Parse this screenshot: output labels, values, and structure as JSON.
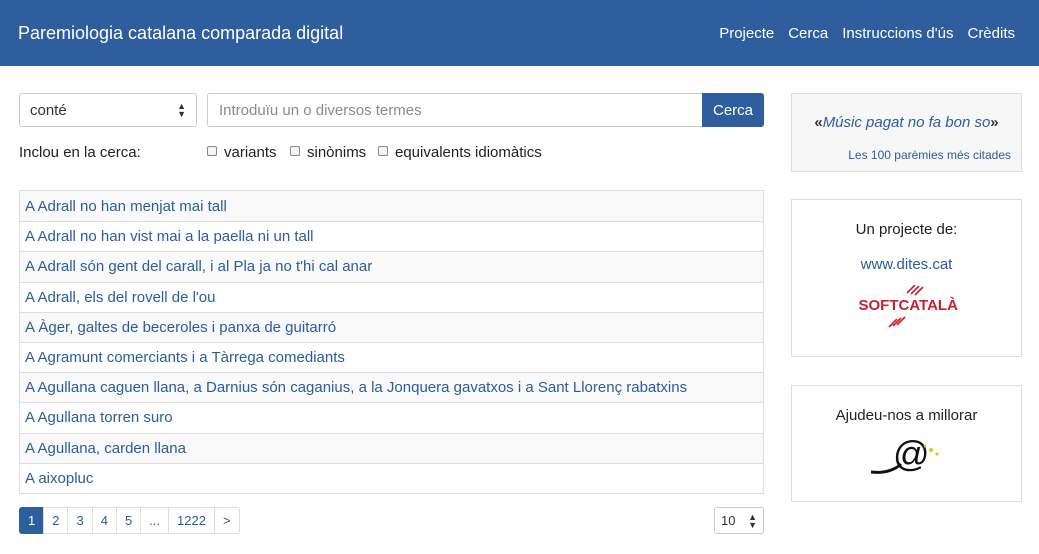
{
  "navbar": {
    "brand": "Paremiologia catalana comparada digital",
    "links": [
      "Projecte",
      "Cerca",
      "Instruccions d'ús",
      "Crèdits"
    ]
  },
  "search": {
    "mode": "conté",
    "placeholder": "Introduïu un o diversos termes",
    "button": "Cerca"
  },
  "filters": {
    "label": "Inclou en la cerca:",
    "options": [
      "variants",
      "sinònims",
      "equivalents idiomàtics"
    ]
  },
  "results": [
    "A Adrall no han menjat mai tall",
    "A Adrall no han vist mai a la paella ni un tall",
    "A Adrall són gent del carall, i al Pla ja no t'hi cal anar",
    "A Adrall, els del rovell de l'ou",
    "A Àger, galtes de beceroles i panxa de guitarró",
    "A Agramunt comerciants i a Tàrrega comediants",
    "A Agullana caguen llana, a Darnius són caganius, a la Jonquera gavatxos i a Sant Llorenç rabatxins",
    "A Agullana torren suro",
    "A Agullana, carden llana",
    "A aixopluc"
  ],
  "pagination": {
    "pages": [
      "1",
      "2",
      "3",
      "4",
      "5",
      "...",
      "1222",
      ">"
    ],
    "active": "1",
    "per_page": "10"
  },
  "sidebar": {
    "quote_open": "«",
    "quote_text": "Músic pagat no fa bon so",
    "quote_close": "»",
    "top100_link": "Les 100 parèmies més citades",
    "project_label": "Un projecte de:",
    "project_link": "www.dites.cat",
    "softcatala_logo": "SOFTCATALÀ",
    "help_label": "Ajudeu-nos a millorar"
  },
  "colors": {
    "navbar": "#2e5e9e",
    "link": "#2a5d9f",
    "softcatala_red": "#c8202f"
  }
}
